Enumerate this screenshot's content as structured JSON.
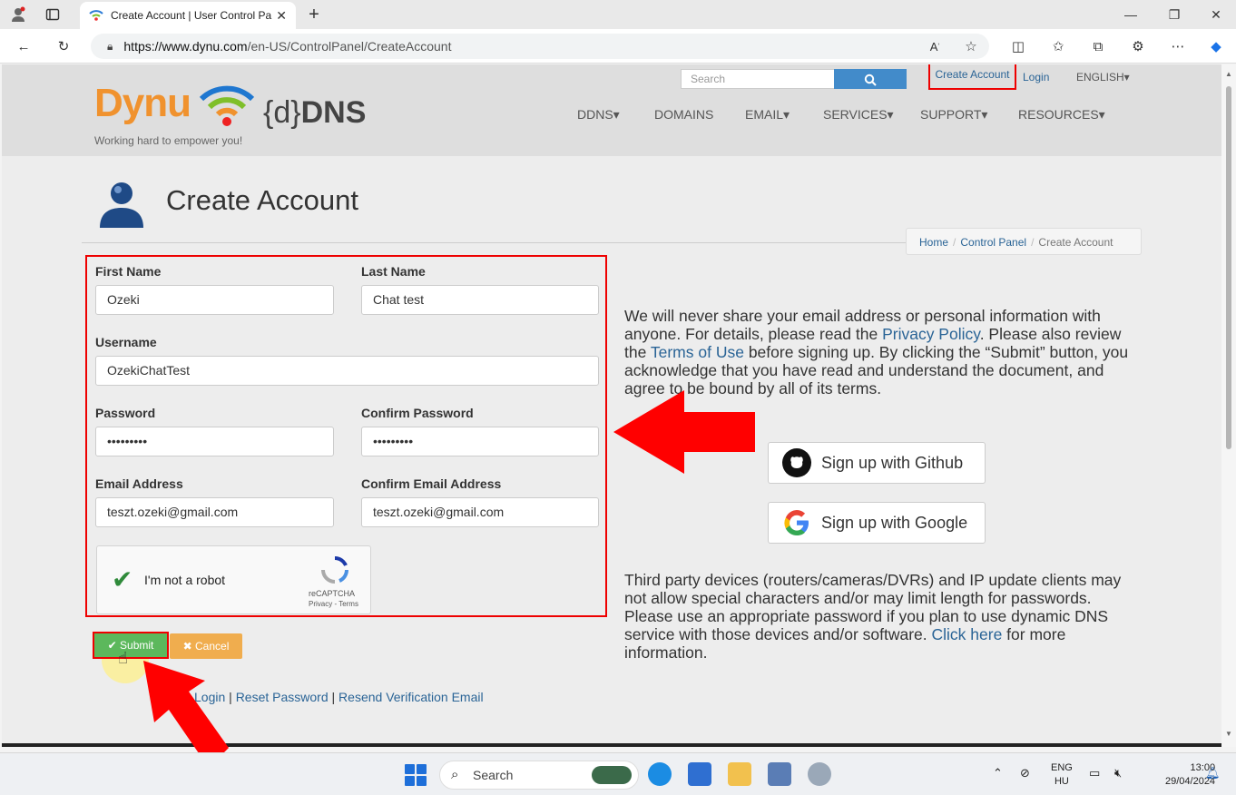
{
  "browser": {
    "tab_title": "Create Account | User Control Pa",
    "url_host": "https://www.dynu.com",
    "url_path": "/en-US/ControlPanel/CreateAccount"
  },
  "site": {
    "logo_text": "Dynu",
    "logo_ddns_brace": "{d}",
    "logo_ddns_bold": "DNS",
    "tagline": "Working hard to empower you!",
    "search_placeholder": "Search",
    "create_account_link": "Create Account",
    "login_link": "Login",
    "language": "ENGLISH▾",
    "nav": [
      "DDNS▾",
      "DOMAINS",
      "EMAIL▾",
      "SERVICES▾",
      "SUPPORT▾",
      "RESOURCES▾"
    ]
  },
  "page": {
    "title": "Create Account",
    "breadcrumb": [
      "Home",
      "Control Panel",
      "Create Account"
    ]
  },
  "form": {
    "first_name_label": "First Name",
    "first_name_value": "Ozeki",
    "last_name_label": "Last Name",
    "last_name_value": "Chat test",
    "username_label": "Username",
    "username_value": "OzekiChatTest",
    "password_label": "Password",
    "password_value": "•••••••••",
    "confirm_password_label": "Confirm Password",
    "confirm_password_value": "•••••••••",
    "email_label": "Email Address",
    "email_value": "teszt.ozeki@gmail.com",
    "confirm_email_label": "Confirm Email Address",
    "confirm_email_value": "teszt.ozeki@gmail.com",
    "captcha_label": "I'm not a robot",
    "captcha_brand": "reCAPTCHA",
    "captcha_sub": "Privacy - Terms",
    "submit_label": "✔ Submit",
    "cancel_label": "✖ Cancel"
  },
  "footer_links": {
    "login": "Login",
    "sep1": " | ",
    "reset": "Reset Password",
    "sep2": " | ",
    "resend": "Resend Verification Email"
  },
  "privacy": {
    "part1": "We will never share your email address or personal information with anyone. For details, please read the ",
    "privacy_link": "Privacy Policy",
    "part2": ". Please also review the ",
    "terms_link": "Terms of Use",
    "part3": " before signing up. By clicking the “Submit” button, you acknowledge that you have read and understand the document, and agree to be bound by all of its terms."
  },
  "social": {
    "github": "Sign up with Github",
    "google": "Sign up with Google"
  },
  "third_party": {
    "text": "Third party devices (routers/cameras/DVRs) and IP update clients may not allow special characters and/or may limit length for passwords. Please use an appropriate password if you plan to use dynamic DNS service with those devices and/or software. ",
    "link": "Click here",
    "tail": " for more information."
  },
  "taskbar": {
    "search": "Search",
    "lang_top": "ENG",
    "lang_bottom": "HU",
    "time": "13:00",
    "date": "29/04/2024"
  },
  "colors": {
    "accent_blue": "#428bca",
    "link": "#2a6496",
    "submit_green": "#5cb85c",
    "cancel_orange": "#f0ad4e",
    "highlight_red": "#e00000"
  }
}
